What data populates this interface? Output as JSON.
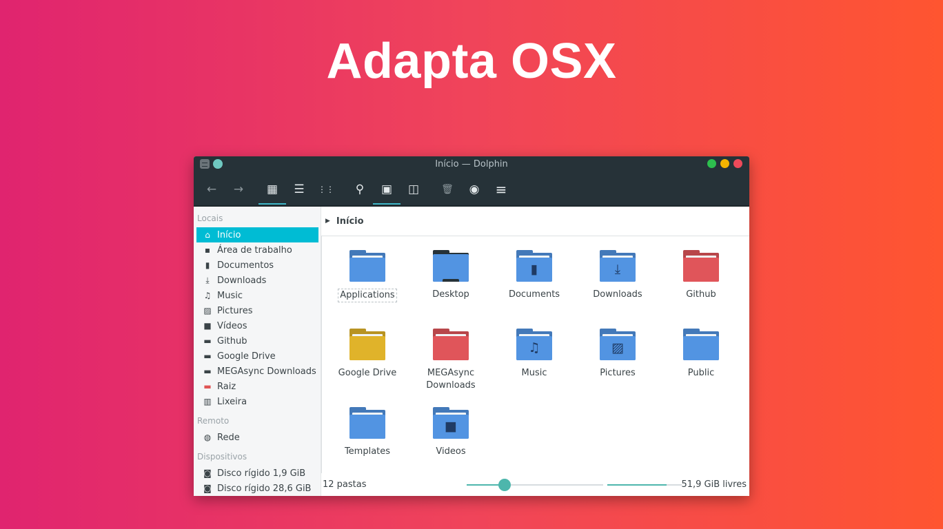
{
  "headline": "Adapta OSX",
  "window": {
    "title": "Início — Dolphin",
    "controls": [
      {
        "name": "minimize",
        "color": "#2dbf4e"
      },
      {
        "name": "maximize",
        "color": "#f4b400"
      },
      {
        "name": "close",
        "color": "#ee4a5a"
      }
    ]
  },
  "toolbar": {
    "back_icon": "←",
    "forward_icon": "→",
    "icons_view_icon": "▦",
    "details_view_icon": "☰",
    "compact_view_icon": "⋮⋮",
    "search_icon": "⚲",
    "preview_icon": "▣",
    "split_icon": "◫",
    "trash_icon": "🗑",
    "hidden_icon": "◉",
    "menu_icon": "≡"
  },
  "sidebar": {
    "places_title": "Locais",
    "places": [
      {
        "label": "Início",
        "icon": "⌂"
      },
      {
        "label": "Área de trabalho",
        "icon": "▪"
      },
      {
        "label": "Documentos",
        "icon": "▮"
      },
      {
        "label": "Downloads",
        "icon": "⤓"
      },
      {
        "label": "Music",
        "icon": "♫"
      },
      {
        "label": "Pictures",
        "icon": "▨"
      },
      {
        "label": "Vídeos",
        "icon": "■"
      },
      {
        "label": "Github",
        "icon": "▬"
      },
      {
        "label": "Google Drive",
        "icon": "▬"
      },
      {
        "label": "MEGAsync Downloads",
        "icon": "▬"
      },
      {
        "label": "Raiz",
        "icon": "▬"
      },
      {
        "label": "Lixeira",
        "icon": "▥"
      }
    ],
    "remote_title": "Remoto",
    "remote": [
      {
        "label": "Rede",
        "icon": "◍"
      }
    ],
    "devices_title": "Dispositivos",
    "devices": [
      {
        "label": "Disco rígido 1,9 GiB",
        "icon": "◙"
      },
      {
        "label": "Disco rígido 28,6 GiB",
        "icon": "◙"
      }
    ]
  },
  "breadcrumb": {
    "arrow": "▶",
    "label": "Início"
  },
  "folders": [
    {
      "label": "Applications",
      "color": "#5294e2",
      "glyph": ""
    },
    {
      "label": "Desktop",
      "color": "#5294e2",
      "glyph": ""
    },
    {
      "label": "Documents",
      "color": "#5294e2",
      "glyph": "▮"
    },
    {
      "label": "Downloads",
      "color": "#5294e2",
      "glyph": "⤓"
    },
    {
      "label": "Github",
      "color": "#e0555a",
      "glyph": ""
    },
    {
      "label": "Google Drive",
      "color": "#e0b32a",
      "glyph": ""
    },
    {
      "label": "MEGAsync Downloads",
      "color": "#e0555a",
      "glyph": ""
    },
    {
      "label": "Music",
      "color": "#5294e2",
      "glyph": "♫"
    },
    {
      "label": "Pictures",
      "color": "#5294e2",
      "glyph": "▨"
    },
    {
      "label": "Public",
      "color": "#5294e2",
      "glyph": ""
    },
    {
      "label": "Templates",
      "color": "#5294e2",
      "glyph": ""
    },
    {
      "label": "Videos",
      "color": "#5294e2",
      "glyph": "■"
    }
  ],
  "status": {
    "folder_count": "12 pastas",
    "zoom_level": 0.28,
    "free_space_label": "51,9 GiB livres",
    "used_fraction": 0.8
  }
}
